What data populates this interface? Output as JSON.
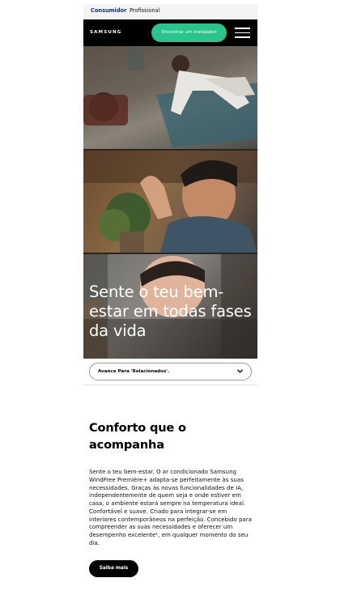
{
  "top_tabs": {
    "consumer": "Consumidor",
    "professional": "Profissional"
  },
  "header": {
    "logo": "SAMSUNG",
    "cta_label": "Encontrar um instalador",
    "menu_icon": "menu-icon"
  },
  "hero": {
    "title": "Sente o teu bem-estar em todas fases da vida"
  },
  "jump_nav": {
    "label": "Avance Para 'Relacionados'."
  },
  "section": {
    "title": "Conforto que o acompanha",
    "body": "Sente o teu bem-estar. O ar condicionado Samsung WindFree Première+ adapta-se perfeitamente às suas necessidades. Graças às novas funcionalidades de IA, independentemente de quem seja e onde estiver em casa, o ambiente estará sempre na temperatura ideal. Confortável e suave. Criado para integrar-se em interiores contemporâneos na perfeição. Concebido para compreender as suas necessidades e oferecer um desempenho excelente¹, em qualquer momento do seu dia.",
    "button_label": "Saiba mais"
  },
  "colors": {
    "brand_blue": "#1428a0",
    "cta_green": "#2bc48f",
    "header_bg": "#000000"
  }
}
